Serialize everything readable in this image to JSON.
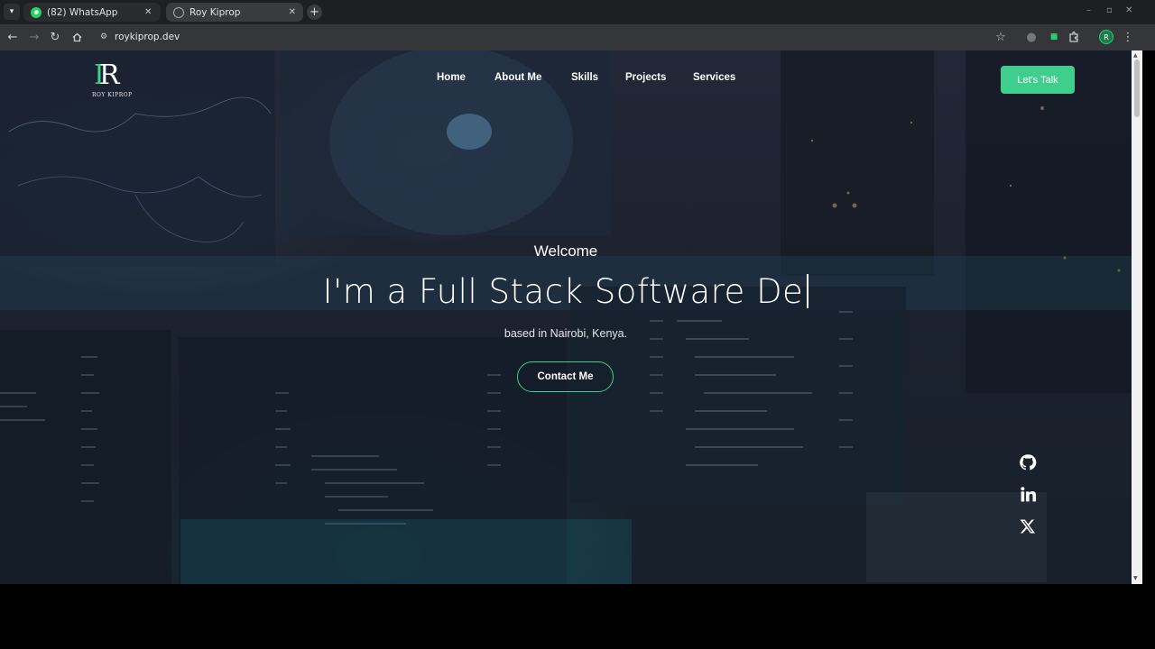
{
  "browser": {
    "tabs": [
      {
        "title": "(82) WhatsApp",
        "icon": "whatsapp-icon"
      },
      {
        "title": "Roy Kiprop",
        "icon": "globe-icon",
        "active": true
      }
    ],
    "url": "roykiprop.dev",
    "profile_initial": "R"
  },
  "site": {
    "logo": {
      "mark_letters": "R",
      "name": "ROY KIPROP"
    },
    "nav": [
      "Home",
      "About Me",
      "Skills",
      "Projects",
      "Services"
    ],
    "cta_label": "Let's Talk",
    "hero": {
      "welcome": "Welcome",
      "headline": "I'm a Full Stack Software De",
      "subline": "based in Nairobi, Kenya.",
      "button": "Contact Me"
    },
    "social": [
      "github-icon",
      "linkedin-icon",
      "x-icon"
    ],
    "colors": {
      "accent": "#3ecf8e",
      "text": "#ffffff"
    }
  }
}
